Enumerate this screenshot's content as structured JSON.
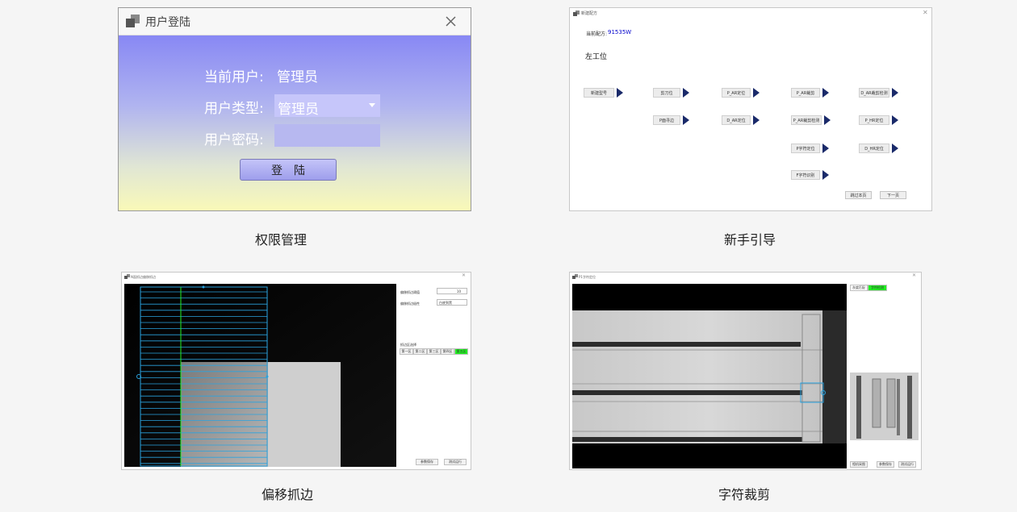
{
  "captions": {
    "p1": "权限管理",
    "p2": "新手引导",
    "p3": "偏移抓边",
    "p4": "字符裁剪"
  },
  "login": {
    "title": "用户登陆",
    "current_user_label": "当前用户:",
    "current_user_value": "管理员",
    "user_type_label": "用户类型:",
    "user_type_value": "管理员",
    "password_label": "用户密码:",
    "password_value": "",
    "login_button": "登　陆",
    "close_icon": "close-icon",
    "app_icon": "app-window-icon"
  },
  "guide": {
    "title": "新建配方",
    "recipe_label": "当前配方:",
    "recipe_value": "91535W",
    "station_label": "左工位",
    "steps": [
      "新建型号",
      "剪刀位",
      "P_AR定位",
      "P_AR裁剪",
      "D_AR裁剪检测",
      "P面寻边",
      "D_AR定位",
      "P_AR裁剪检测",
      "P_HR定位",
      "P字符定位",
      "D_HR定位",
      "F字符识别"
    ],
    "skip_button": "跳过本页",
    "next_button": "下一页"
  },
  "offset": {
    "title": "N面抓边偏移抓边",
    "threshold_label": "偏移抓边阈值",
    "threshold_value": "10",
    "polarity_label": "偏移抓边极性",
    "polarity_value": "白底到黑",
    "section_label": "抓边区选择",
    "tabs": [
      "第一区",
      "第二区",
      "第三区",
      "第四区",
      "第五区"
    ],
    "save_button": "参数保存",
    "test_button": "测试运行"
  },
  "crop": {
    "title": "P1字符定位",
    "tabs": [
      "灰度匹配",
      "字符检测"
    ],
    "camera_button": "相机采图",
    "save_button": "参数保存",
    "test_button": "测试运行"
  },
  "colors": {
    "accent_green": "#22ee22",
    "guide_arrow": "#1a2a6a",
    "roi_blue": "#2aa3e0"
  }
}
